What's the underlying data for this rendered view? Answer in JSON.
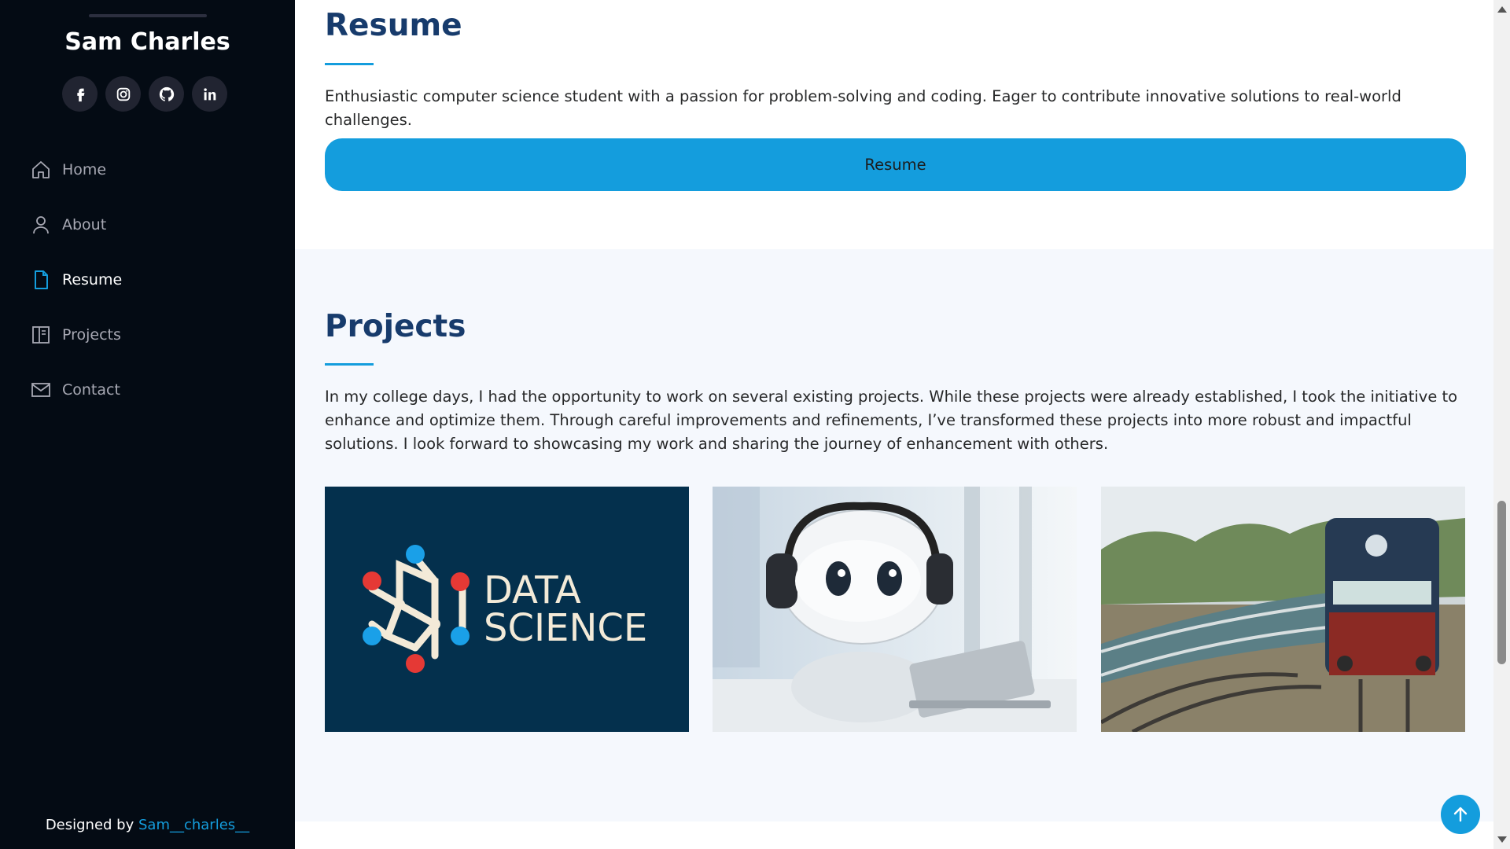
{
  "sidebar": {
    "name": "Sam Charles",
    "socials": [
      {
        "icon": "facebook-icon"
      },
      {
        "icon": "instagram-icon"
      },
      {
        "icon": "github-icon"
      },
      {
        "icon": "linkedin-icon"
      }
    ],
    "nav": [
      {
        "label": "Home",
        "icon": "home-icon",
        "active": false
      },
      {
        "label": "About",
        "icon": "user-icon",
        "active": false
      },
      {
        "label": "Resume",
        "icon": "file-icon",
        "active": true
      },
      {
        "label": "Projects",
        "icon": "book-icon",
        "active": false
      },
      {
        "label": "Contact",
        "icon": "envelope-icon",
        "active": false
      }
    ],
    "credit_prefix": "Designed by ",
    "credit_link": "Sam__charles__"
  },
  "resume": {
    "title": "Resume",
    "text": "Enthusiastic computer science student with a passion for problem-solving and coding. Eager to contribute innovative solutions to real-world challenges.",
    "button_label": "Resume"
  },
  "projects": {
    "title": "Projects",
    "text": "In my college days, I had the opportunity to work on several existing projects. While these projects were already established, I took the initiative to enhance and optimize them. Through careful improvements and refinements, I’ve transformed these projects into more robust and impactful solutions. I look forward to showcasing my work and sharing the journey of enhancement with others.",
    "cards": [
      {
        "name": "data-science-card",
        "line1": "DATA",
        "line2": "SCIENCE"
      },
      {
        "name": "robot-assistant-card"
      },
      {
        "name": "train-card"
      }
    ]
  },
  "colors": {
    "accent": "#149ddd",
    "sidebar_bg": "#040b14",
    "heading": "#173b6c"
  }
}
